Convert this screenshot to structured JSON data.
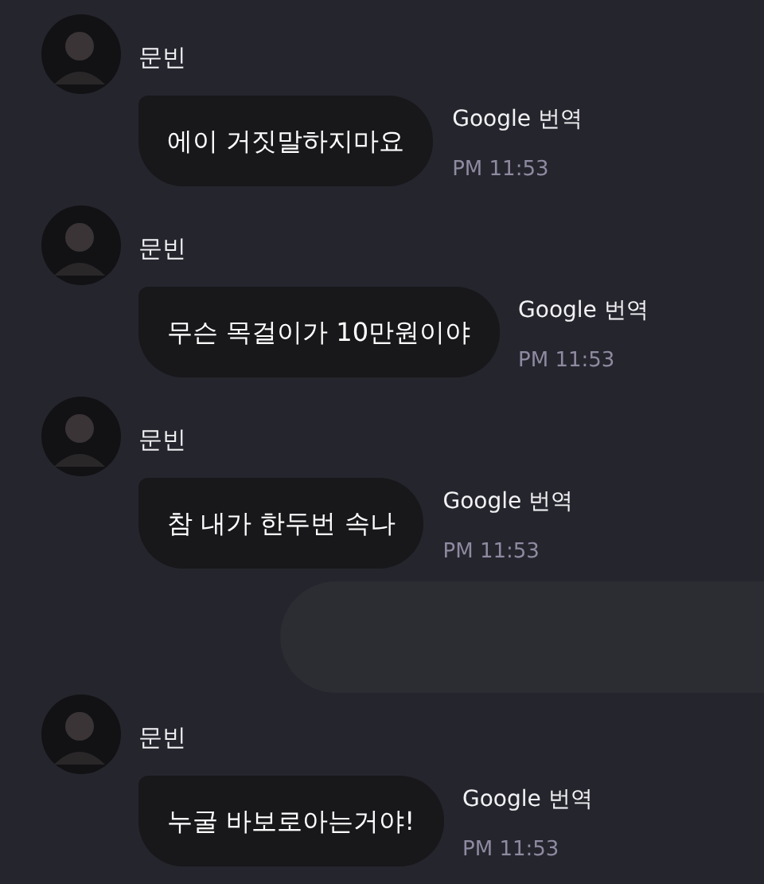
{
  "messages": [
    {
      "kind": "incoming",
      "sender": "문빈",
      "text": "에이 거짓말하지마요",
      "translate": "Google 번역",
      "time": "PM 11:53"
    },
    {
      "kind": "incoming",
      "sender": "문빈",
      "text": "무슨 목걸이가 10만원이야",
      "translate": "Google 번역",
      "time": "PM 11:53"
    },
    {
      "kind": "incoming",
      "sender": "문빈",
      "text": "참 내가 한두번 속나",
      "translate": "Google 번역",
      "time": "PM 11:53"
    },
    {
      "kind": "blank"
    },
    {
      "kind": "incoming",
      "sender": "문빈",
      "text": "누굴 바보로아는거야!",
      "translate": "Google 번역",
      "time": "PM 11:53"
    }
  ]
}
